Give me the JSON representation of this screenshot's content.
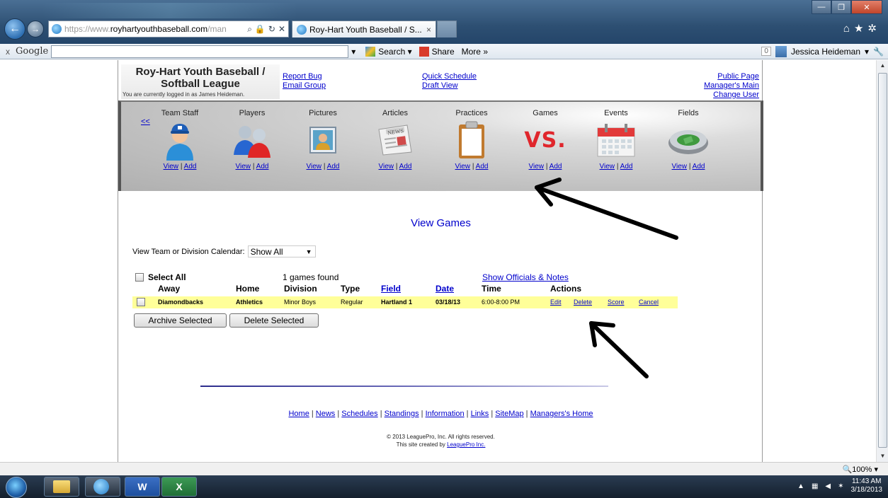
{
  "browser": {
    "address_prefix": "https://www.",
    "address_domain": "royhartyouthbaseball.com",
    "address_suffix": "/man",
    "tab_title": "Roy-Hart Youth Baseball / S...",
    "tab_close": "×"
  },
  "google_toolbar": {
    "close": "x",
    "logo": "Google",
    "search_label": "Search",
    "share_label": "Share",
    "more_label": "More »",
    "count": "0",
    "user": "Jessica Heideman"
  },
  "header": {
    "title_line1": "Roy-Hart Youth Baseball /",
    "title_line2": "Softball League",
    "login_text": "You are currently logged in as James Heideman.",
    "links_a": [
      "Report Bug",
      "Email Group"
    ],
    "links_b": [
      "Quick Schedule",
      "Draft View"
    ],
    "links_c": [
      "Public Page",
      "Manager's Main",
      "Change User"
    ]
  },
  "menu": {
    "back": "<<",
    "view": "View",
    "sep": "|",
    "add": "Add",
    "items": [
      {
        "label": "Team Staff",
        "icon": "team-staff-icon"
      },
      {
        "label": "Players",
        "icon": "players-icon"
      },
      {
        "label": "Pictures",
        "icon": "pictures-icon"
      },
      {
        "label": "Articles",
        "icon": "articles-icon"
      },
      {
        "label": "Practices",
        "icon": "clipboard-icon"
      },
      {
        "label": "Games",
        "icon": "vs-icon"
      },
      {
        "label": "Events",
        "icon": "calendar-icon"
      },
      {
        "label": "Fields",
        "icon": "stadium-icon"
      }
    ],
    "vs_text": "VS.",
    "news_text": "NEWS"
  },
  "content": {
    "title": "View Games",
    "calendar_label": "View Team or Division Calendar:",
    "calendar_value": "Show All",
    "select_all": "Select All",
    "games_found": "1 games found",
    "show_officials": "Show Officials & Notes",
    "columns": {
      "away": "Away",
      "home": "Home",
      "division": "Division",
      "type": "Type",
      "field": "Field",
      "date": "Date",
      "time": "Time",
      "actions": "Actions"
    },
    "row": {
      "away": "Diamondbacks",
      "home": "Athletics",
      "division": "Minor Boys",
      "type": "Regular",
      "field": "Hartland 1",
      "date": "03/18/13",
      "time": "6:00-8:00 PM",
      "edit": "Edit",
      "delete": "Delete",
      "score": "Score",
      "cancel": "Cancel"
    },
    "archive_button": "Archive Selected",
    "delete_button": "Delete Selected"
  },
  "footer": {
    "links": [
      "Home",
      "News",
      "Schedules",
      "Standings",
      "Information",
      "Links",
      "SiteMap",
      "Managers's Home"
    ],
    "sep": " | ",
    "copyright": "© 2013 LeaguePro, Inc. All rights reserved.",
    "created_prefix": "This site created by ",
    "created_link": "LeaguePro Inc."
  },
  "status": {
    "zoom": "100%"
  },
  "taskbar": {
    "time": "11:43 AM",
    "date": "3/18/2013",
    "word": "W",
    "excel": "X"
  },
  "colors": {
    "row_highlight": "#ffff99",
    "link": "#0000cc",
    "vs_red": "#e0262c"
  }
}
